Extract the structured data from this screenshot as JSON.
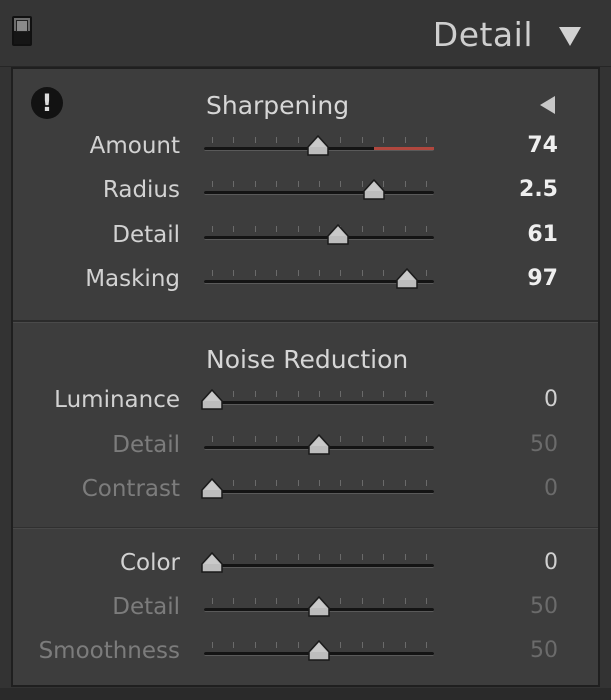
{
  "header": {
    "title": "Detail"
  },
  "sharpening": {
    "title": "Sharpening",
    "rows": [
      {
        "label": "Amount",
        "value": "74",
        "level": 0.497
      },
      {
        "label": "Radius",
        "value": "2.5",
        "level": 0.758
      },
      {
        "label": "Detail",
        "value": "61",
        "level": 0.591
      },
      {
        "label": "Masking",
        "value": "97",
        "level": 0.91
      }
    ],
    "amount_red_range": [
      0.74,
      1.0
    ]
  },
  "noise_reduction": {
    "title": "Noise Reduction",
    "luminance_rows": [
      {
        "label": "Luminance",
        "value": "0",
        "level": 0.0,
        "state": "plain"
      },
      {
        "label": "Detail",
        "value": "50",
        "level": 0.5,
        "state": "dim"
      },
      {
        "label": "Contrast",
        "value": "0",
        "level": 0.0,
        "state": "dim"
      }
    ],
    "color_rows": [
      {
        "label": "Color",
        "value": "0",
        "level": 0.0,
        "state": "plain"
      },
      {
        "label": "Detail",
        "value": "50",
        "level": 0.5,
        "state": "dim"
      },
      {
        "label": "Smoothness",
        "value": "50",
        "level": 0.5,
        "state": "dim"
      }
    ]
  },
  "colors": {
    "track": "#141414",
    "thumb": "#bdbdbd",
    "accent_red": "#b0473e"
  },
  "icons": {
    "panel_toggle": "panel-switch-icon",
    "collapse": "triangle-down-icon",
    "warning": "exclamation-circle-icon",
    "disclose": "triangle-left-icon"
  }
}
